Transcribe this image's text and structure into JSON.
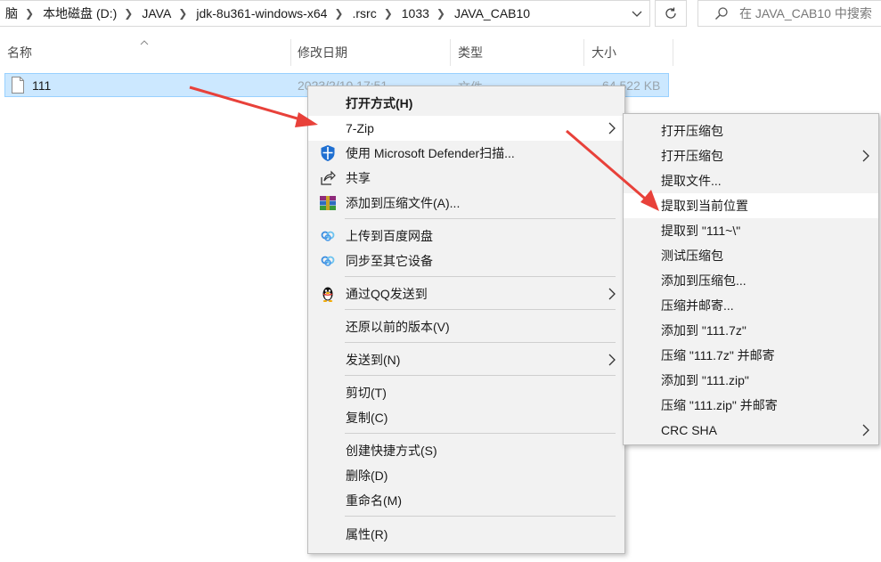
{
  "address_bar": {
    "crumbs": [
      "脑",
      "本地磁盘 (D:)",
      "JAVA",
      "jdk-8u361-windows-x64",
      ".rsrc",
      "1033",
      "JAVA_CAB10"
    ],
    "separator_icon": "chevron-right-icon",
    "dropdown_icon": "chevron-down-icon",
    "refresh_icon": "refresh-icon"
  },
  "search": {
    "placeholder": "在 JAVA_CAB10 中搜索",
    "icon": "search-icon"
  },
  "columns": {
    "name": "名称",
    "date": "修改日期",
    "type": "类型",
    "size": "大小",
    "sort_icon": "sort-up-icon"
  },
  "file": {
    "name": "111",
    "date": "2023/2/10 17:51",
    "type": "文件",
    "size": "64,522 KB",
    "icon": "file-icon"
  },
  "context_menu": {
    "open_with": "打开方式(H)",
    "seven_zip": "7-Zip",
    "defender": "使用 Microsoft Defender扫描...",
    "share": "共享",
    "add_to_archive": "添加到压缩文件(A)...",
    "upload_baidu": "上传到百度网盘",
    "sync_devices": "同步至其它设备",
    "send_qq": "通过QQ发送到",
    "restore_versions": "还原以前的版本(V)",
    "send_to": "发送到(N)",
    "cut": "剪切(T)",
    "copy": "复制(C)",
    "create_shortcut": "创建快捷方式(S)",
    "delete": "删除(D)",
    "rename": "重命名(M)",
    "properties": "属性(R)"
  },
  "submenu_7zip": {
    "items": [
      "打开压缩包",
      "打开压缩包",
      "提取文件...",
      "提取到当前位置",
      "提取到 \"111~\\\"",
      "测试压缩包",
      "添加到压缩包...",
      "压缩并邮寄...",
      "添加到 \"111.7z\"",
      "压缩 \"111.7z\" 并邮寄",
      "添加到 \"111.zip\"",
      "压缩 \"111.zip\" 并邮寄",
      "CRC SHA"
    ],
    "highlighted_index": 3
  },
  "colors": {
    "selection_bg": "#cce8ff",
    "selection_border": "#99d1ff",
    "menu_bg": "#f2f2f2",
    "arrow_red": "#e8413a"
  }
}
